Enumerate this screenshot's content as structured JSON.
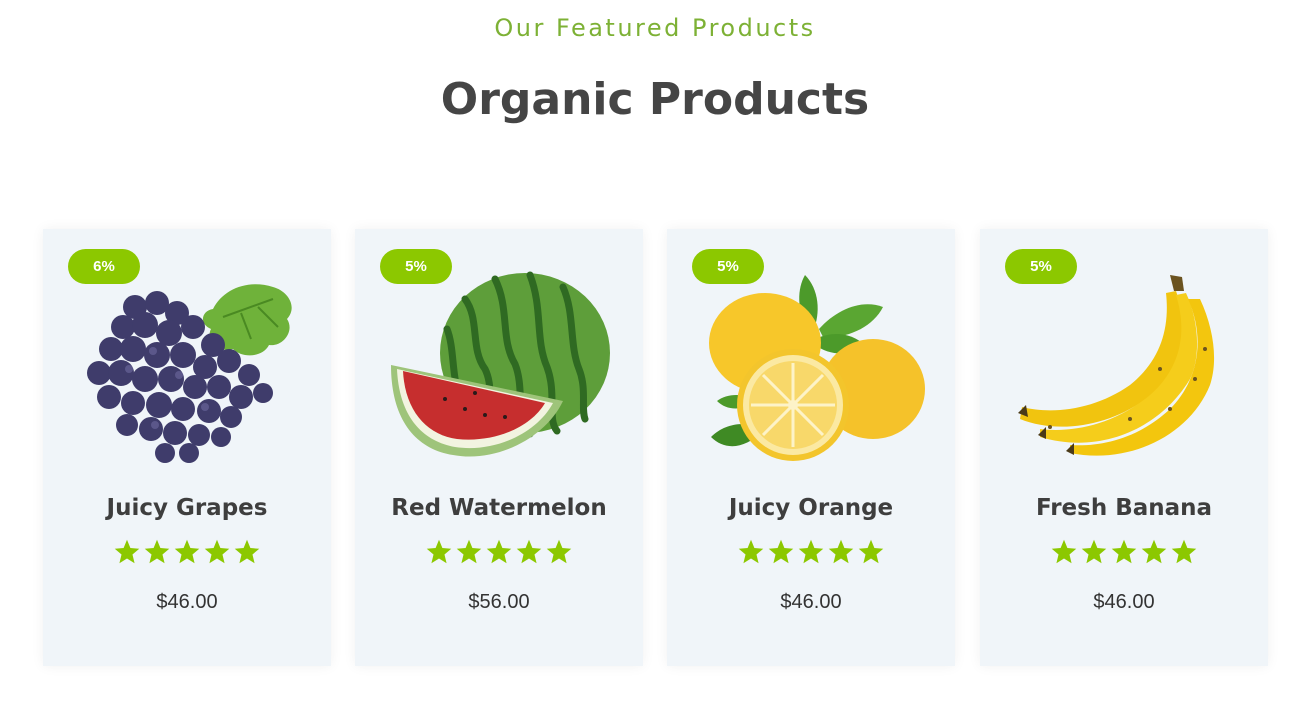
{
  "header": {
    "subtitle": "Our Featured Products",
    "title": "Organic Products"
  },
  "products": [
    {
      "name": "Juicy Grapes",
      "discount": "6%",
      "price": "$46.00",
      "rating": 5,
      "image": "grapes-image"
    },
    {
      "name": "Red Watermelon",
      "discount": "5%",
      "price": "$56.00",
      "rating": 5,
      "image": "watermelon-image"
    },
    {
      "name": "Juicy Orange",
      "discount": "5%",
      "price": "$46.00",
      "rating": 5,
      "image": "lemon-image"
    },
    {
      "name": "Fresh Banana",
      "discount": "5%",
      "price": "$46.00",
      "rating": 5,
      "image": "banana-image"
    }
  ],
  "colors": {
    "accent": "#8cc800",
    "star": "#8cc800",
    "subtitle": "#7db135",
    "card_bg": "#f0f5f9",
    "title": "#454545"
  }
}
